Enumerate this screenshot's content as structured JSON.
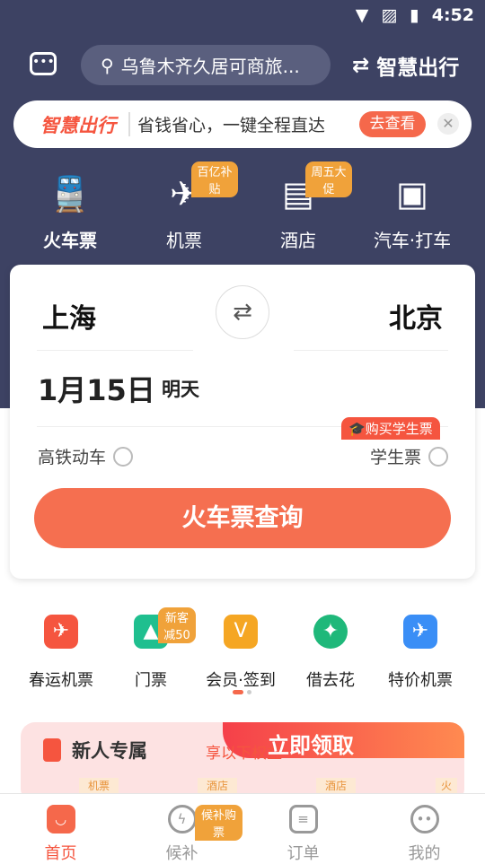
{
  "status": {
    "time": "4:52"
  },
  "header": {
    "search_placeholder": "乌鲁木齐久居可商旅...",
    "smart_label": "智慧出行"
  },
  "banner": {
    "brand": "智慧出行",
    "slogan": "省钱省心，一键全程直达",
    "button": "去查看"
  },
  "tabs": [
    {
      "label": "火车票",
      "icon": "train-icon"
    },
    {
      "label": "机票",
      "icon": "plane-icon",
      "badge": "百亿补贴"
    },
    {
      "label": "酒店",
      "icon": "hotel-icon",
      "badge": "周五大促"
    },
    {
      "label": "汽车·打车",
      "icon": "bus-icon"
    }
  ],
  "search_card": {
    "from": "上海",
    "to": "北京",
    "date": "1月15日",
    "day": "明天",
    "student_badge": "购买学生票",
    "option_highspeed": "高铁动车",
    "option_student": "学生票",
    "query_button": "火车票查询"
  },
  "grid": [
    {
      "label": "春运机票",
      "color": "#f5553f"
    },
    {
      "label": "门票",
      "color": "#1fbf8f",
      "badge": "新客减50"
    },
    {
      "label": "会员·签到",
      "color": "#f5a623"
    },
    {
      "label": "借去花",
      "color": "#1fb87a"
    },
    {
      "label": "特价机票",
      "color": "#3a8ef6"
    }
  ],
  "promo": {
    "title": "新人专属",
    "subtitle": "享以下权益",
    "cta": "立即领取",
    "tags": [
      "机票",
      "酒店",
      "酒店",
      "火"
    ]
  },
  "nav": [
    {
      "label": "首页",
      "active": true
    },
    {
      "label": "候补",
      "badge": "候补购票"
    },
    {
      "label": "订单"
    },
    {
      "label": "我的"
    }
  ],
  "colors": {
    "header": "#3d4263",
    "accent": "#f56f50",
    "badge": "#f0a23a"
  }
}
